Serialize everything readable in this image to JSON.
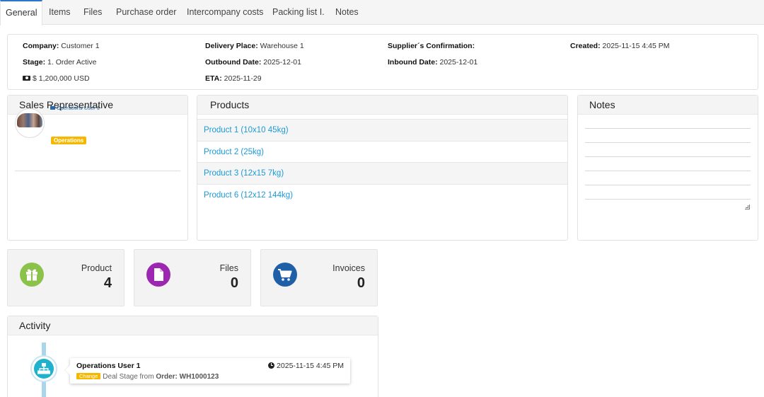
{
  "tabs": [
    {
      "label": "General",
      "active": true
    },
    {
      "label": "Items"
    },
    {
      "label": "Files"
    },
    {
      "label": "Purchase order"
    },
    {
      "label": "Intercompany costs"
    },
    {
      "label": "Packing list I."
    },
    {
      "label": "Notes"
    }
  ],
  "info": {
    "company_label": "Company:",
    "company_value": "Customer 1",
    "stage_label": "Stage:",
    "stage_value": "1. Order Active",
    "amount_value": "$ 1,200,000 USD",
    "delivery_label": "Delivery Place:",
    "delivery_value": "Warehouse 1",
    "outbound_label": "Outbound Date:",
    "outbound_value": "2025-12-01",
    "eta_label": "ETA:",
    "eta_value": "2025-11-29",
    "supplier_label": "Supplier´s Confirmation:",
    "supplier_value": "",
    "inbound_label": "Inbound Date:",
    "inbound_value": "2025-12-01",
    "created_label": "Created:",
    "created_value": "2025-11-15 4:45 PM",
    "icons": {
      "amount": "money-icon"
    }
  },
  "sales_rep": {
    "title": "Sales Representative",
    "name": "Operations User 1",
    "badge": "Operations",
    "badge_color": "#f5b800"
  },
  "products": {
    "title": "Products",
    "items": [
      "Product 1 (10x10 45kg)",
      "Product 2 (25kg)",
      "Product 3 (12x15 7kg)",
      "Product 6 (12x12 144kg)"
    ]
  },
  "notes": {
    "title": "Notes",
    "value": ""
  },
  "stats": [
    {
      "label": "Product",
      "value": "4",
      "icon": "gift-icon",
      "color": "#8bc34a"
    },
    {
      "label": "Files",
      "value": "0",
      "icon": "file-icon",
      "color": "#9c27b0"
    },
    {
      "label": "Invoices",
      "value": "0",
      "icon": "cart-icon",
      "color": "#1f5fa8"
    }
  ],
  "activity": {
    "title": "Activity",
    "entries": [
      {
        "user": "Operations User 1",
        "time": "2025-11-15 4:45 PM",
        "badge": "Change",
        "text_prefix": "Deal Stage from",
        "text_bold": "Order: WH1000123",
        "icon": "sitemap-icon",
        "icon_color": "#1fb2cc"
      }
    ]
  }
}
